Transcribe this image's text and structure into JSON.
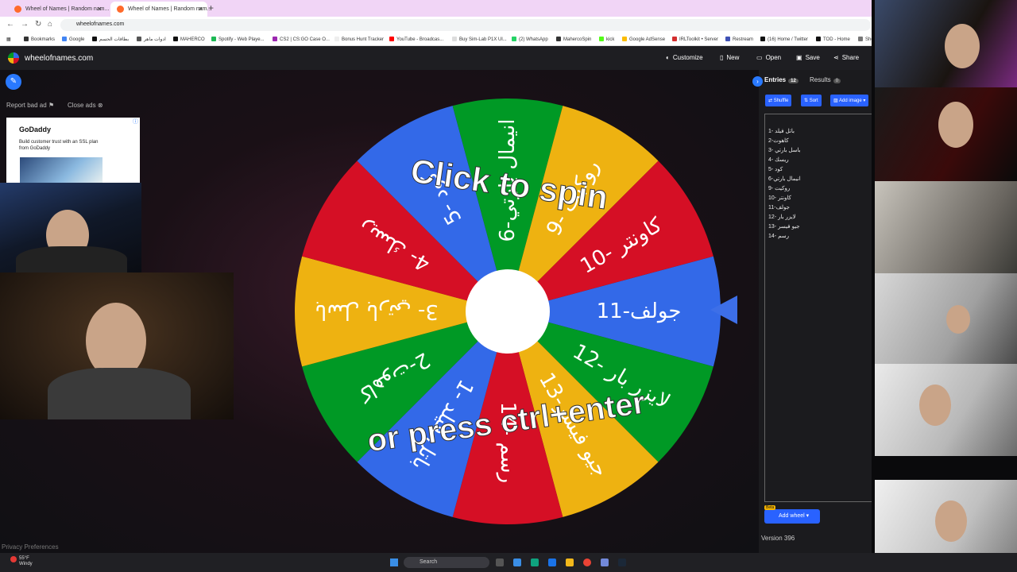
{
  "browser": {
    "tabs": [
      {
        "title": "Wheel of Names | Random nam..."
      },
      {
        "title": "Wheel of Names | Random nam..."
      }
    ],
    "url": "wheelofnames.com",
    "bookmarks": [
      "Bookmarks",
      "Google",
      "بطاقات الحسم",
      "ادوات ماهر",
      "MAHERCO",
      "Spotify - Web Playe...",
      "CS2 | CS:GO Case O...",
      "Bonus Hunt Tracker",
      "YouTube - Broadcas...",
      "Buy Sim-Lab P1X Ul...",
      "(2) WhatsApp",
      "MahercoSpin",
      "kick",
      "Google AdSense",
      "IRLToolkit • Server",
      "Restream",
      "(16) Home / Twitter",
      "TOD - Home",
      "Sho"
    ]
  },
  "app": {
    "brand": "wheelofnames.com",
    "menu": [
      "Customize",
      "New",
      "Open",
      "Save",
      "Share"
    ]
  },
  "ads": {
    "report": "Report bad ad",
    "close": "Close ads",
    "advertiser": "GoDaddy",
    "text": "Build customer trust with an SSL plan from GoDaddy"
  },
  "wheel": {
    "colors": [
      "#3369e8",
      "#009925",
      "#eeb211",
      "#d50f25"
    ],
    "segments": [
      "جولف-11",
      "لايزر بار -12",
      "جيو فيسر-13",
      "رسم -14",
      "باتل فيلد -1",
      "كاهوت-2",
      "باسل بارتي -3",
      "ريسك -4",
      "كود -5",
      "انيمال بارتي-6",
      "روكيت -9",
      "كاونتر -10"
    ],
    "line1": "Click to spin",
    "line2": "or press ctrl+enter"
  },
  "panel": {
    "entries_tab": "Entries",
    "entries_count": "12",
    "results_tab": "Results",
    "results_count": "0",
    "buttons": [
      "Shuffle",
      "Sort",
      "Add image"
    ],
    "entries": [
      "باتل فيلد -1",
      "كاهوت-2",
      "باسل بارتي -3",
      "ريسك -4",
      "كود -5",
      "انيمال بارتي-6",
      "روكيت -9",
      "كاونتر -10",
      "جولف-11",
      "لايزر بار -12",
      "جيو فيسر -13",
      "رسم -14"
    ],
    "add_wheel": "Add wheel",
    "beta": "Beta",
    "version": "Version 396"
  },
  "footer": {
    "privacy": "Privacy Preferences"
  },
  "taskbar": {
    "temp": "55°F",
    "weather": "Windy",
    "search": "Search"
  }
}
